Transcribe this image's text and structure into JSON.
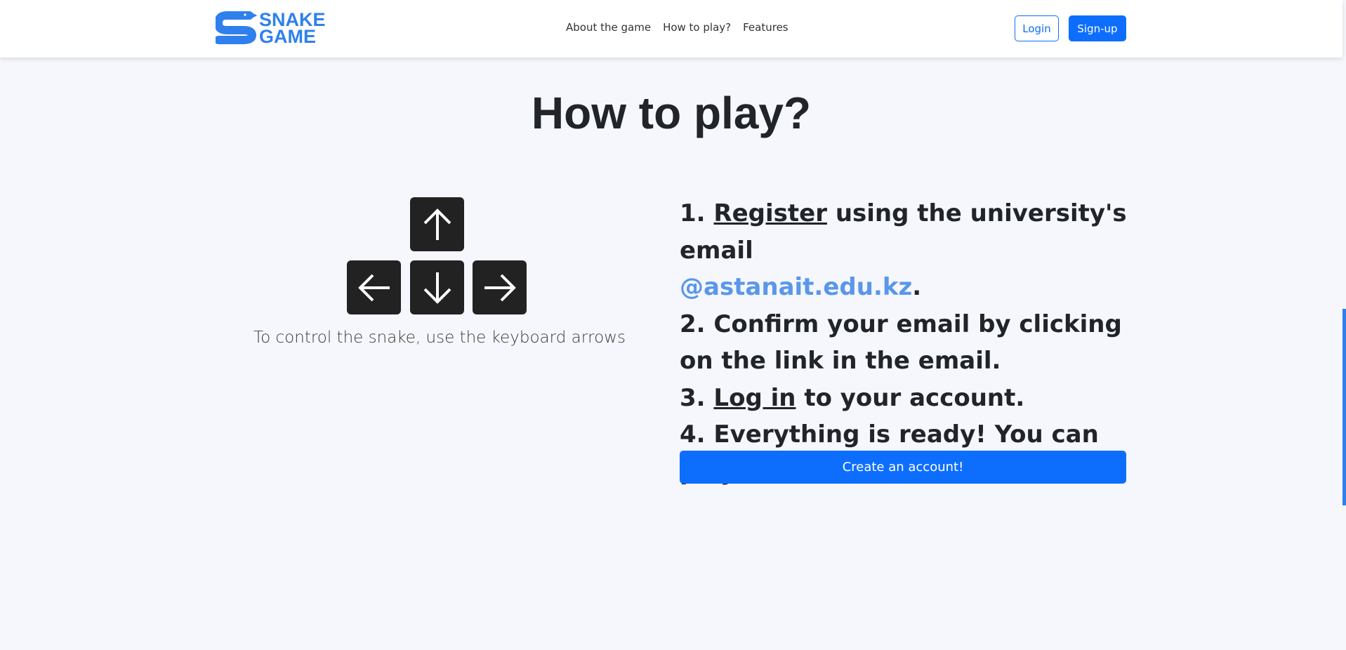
{
  "brand": {
    "logo_line1": "SNAKE",
    "logo_line2": "GAME",
    "color": "#2f80ed"
  },
  "nav": {
    "links": [
      "About the game",
      "How to play?",
      "Features"
    ],
    "login_label": "Login",
    "signup_label": "Sign-up"
  },
  "page": {
    "title": "How to play?",
    "controls_caption": "To control the snake, use the keyboard arrows"
  },
  "steps": {
    "s1_prefix": "1. ",
    "s1_link": "Register",
    "s1_rest": " using the university's email",
    "s1_email": "@astanait.edu.kz",
    "s1_end": ".",
    "s2": "2. Confirm your email by clicking on the link in the email.",
    "s3_prefix": "3. ",
    "s3_link": "Log in",
    "s3_rest": " to your account.",
    "s4": "4. Everything is ready! You can play!"
  },
  "cta": {
    "label": "Create an account!"
  },
  "colors": {
    "primary": "#0d6efd",
    "background": "#f5f7fc",
    "key": "#222222"
  }
}
